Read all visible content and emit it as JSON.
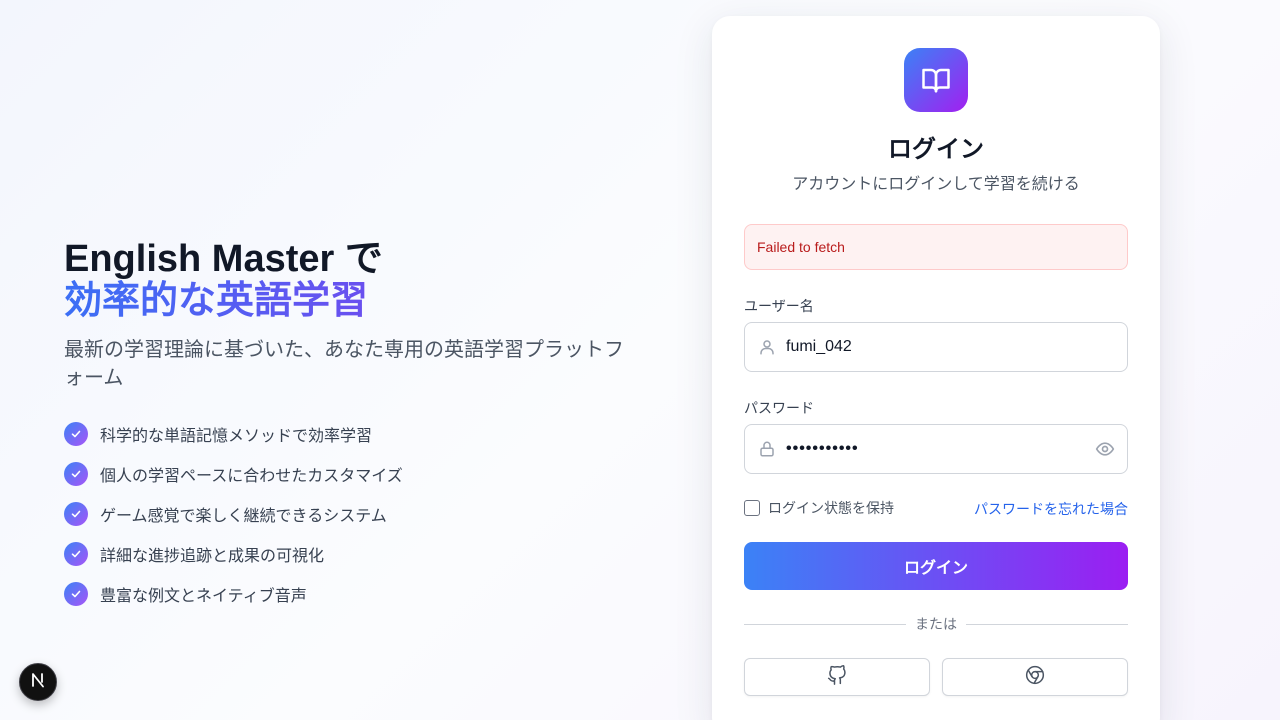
{
  "hero": {
    "title_line1": "English Master で",
    "title_line2": "効率的な英語学習",
    "subtitle": "最新の学習理論に基づいた、あなた専用の英語学習プラットフォーム"
  },
  "features": [
    "科学的な単語記憶メソッドで効率学習",
    "個人の学習ペースに合わせたカスタマイズ",
    "ゲーム感覚で楽しく継続できるシステム",
    "詳細な進捗追跡と成果の可視化",
    "豊富な例文とネイティブ音声"
  ],
  "login": {
    "logo_icon": "book-open-icon",
    "title": "ログイン",
    "subtitle": "アカウントにログインして学習を続ける",
    "error": "Failed to fetch",
    "username_label": "ユーザー名",
    "username_value": "fumi_042",
    "password_label": "パスワード",
    "password_value": "•••••••••••",
    "remember_label": "ログイン状態を保持",
    "forgot_link": "パスワードを忘れた場合",
    "submit_label": "ログイン",
    "divider_text": "または",
    "social": [
      "github-icon",
      "chrome-icon"
    ]
  },
  "colors": {
    "accent_start": "#3b82f6",
    "accent_end": "#9333ea",
    "error_bg": "#fef2f2",
    "error_text": "#b91c1c",
    "link": "#2563eb"
  }
}
